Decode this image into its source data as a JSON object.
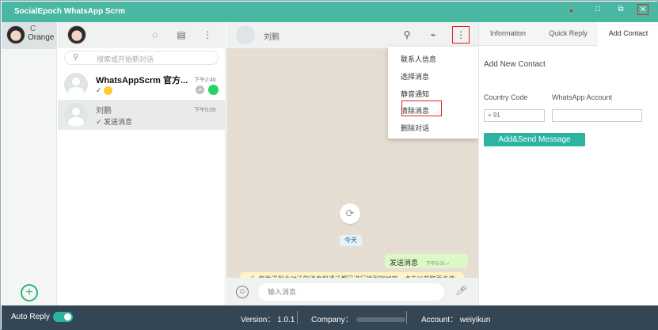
{
  "app": {
    "title": "SocialEpoch WhatsApp Scrm",
    "window_controls": [
      "minimize-icon",
      "maximize-icon",
      "restore-icon",
      "close-icon"
    ]
  },
  "rail": {
    "account_label": "Orange",
    "refresh_glyph": "C",
    "add_glyph": "+"
  },
  "chatlist": {
    "search_placeholder": "搜索或开始新对话",
    "conversations": [
      {
        "name": "WhatsAppScrm 官方...",
        "time": "下午2:40",
        "preview": "✓",
        "has_emoji": true,
        "unread": true
      },
      {
        "name": "刘鹏",
        "time": "下午5:05",
        "preview": "✓ 发送消息"
      }
    ]
  },
  "chat": {
    "contact_name": "刘鹏",
    "date_label": "今天",
    "messages": [
      {
        "text": "发送消息",
        "time": "下午5:05 ✓"
      }
    ],
    "e2e_notice": "🔒 您发送到此对话的消息和通话都已进行端到端加密。点击以获取更多信息。",
    "input_placeholder": "输入消息"
  },
  "menu": {
    "items": [
      "联系人信息",
      "选择消息",
      "静音通知",
      "清除消息",
      "删除对话"
    ],
    "highlighted": "清除消息"
  },
  "rightpanel": {
    "tabs": [
      "Information",
      "Quick Reply",
      "Add Contact"
    ],
    "active_tab": "Add Contact",
    "title": "Add New Contact",
    "country_code_label": "Country Code",
    "country_code_value": "+ 91",
    "account_label": "WhatsApp Account",
    "account_value": "",
    "submit_label": "Add&Send Message"
  },
  "status": {
    "auto_reply_label": "Auto Reply",
    "auto_reply_on": true,
    "version": "Version： 1.0.1",
    "company_label": "Company：",
    "account": "Account： weiyikun"
  },
  "colors": {
    "titlebar": "#4ab7a3",
    "accent": "#2bb5a0",
    "statusbar": "#344654",
    "highlight_border": "#e02020"
  }
}
